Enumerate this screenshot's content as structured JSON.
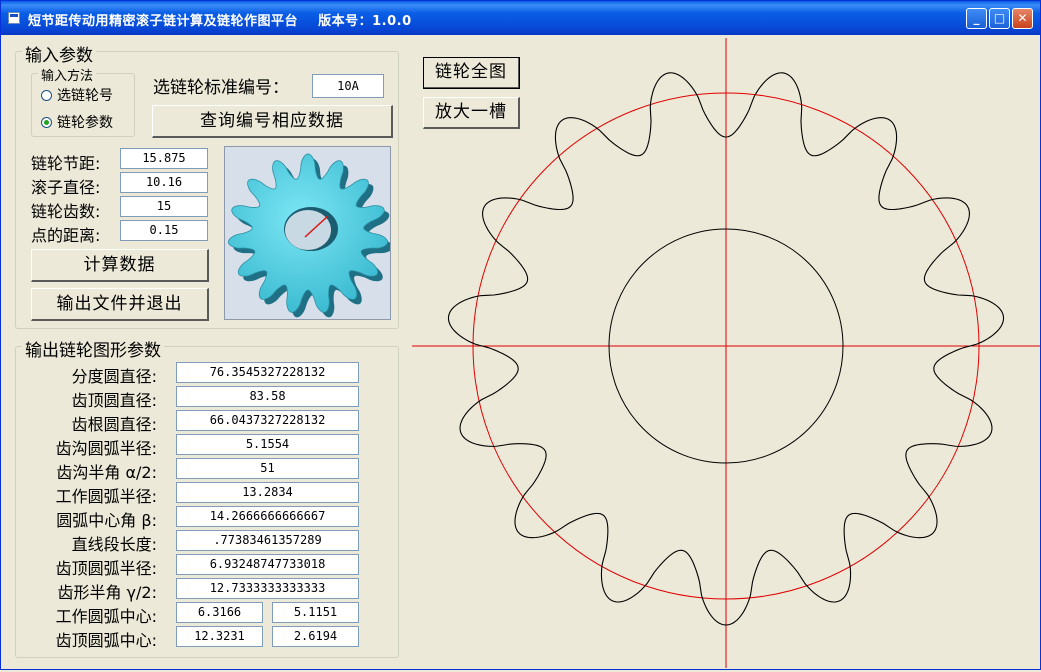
{
  "window": {
    "title": "短节距传动用精密滚子链计算及链轮作图平台    版本号：1.0.0",
    "buttons": {
      "minimize": "_",
      "maximize": "□",
      "close": "✕"
    }
  },
  "input_group": {
    "legend": "输入参数",
    "method_group": {
      "legend": "输入方法",
      "options": [
        {
          "label": "选链轮号",
          "checked": false
        },
        {
          "label": "链轮参数",
          "checked": true
        }
      ]
    },
    "standard_label": "选链轮标准编号：",
    "standard_value": "10A",
    "query_button": "查询编号相应数据",
    "fields": [
      {
        "label": "链轮节距:",
        "value": "15.875"
      },
      {
        "label": "滚子直径:",
        "value": "10.16"
      },
      {
        "label": "链轮齿数:",
        "value": "15"
      },
      {
        "label": "点的距离:",
        "value": "0.15"
      }
    ],
    "calc_button": "计算数据",
    "export_button": "输出文件并退出"
  },
  "output_group": {
    "legend": "输出链轮图形参数",
    "rows": [
      {
        "label": "分度圆直径:",
        "values": [
          "76.3545327228132"
        ]
      },
      {
        "label": "齿顶圆直径:",
        "values": [
          "83.58"
        ]
      },
      {
        "label": "齿根圆直径:",
        "values": [
          "66.0437327228132"
        ]
      },
      {
        "label": "齿沟圆弧半径:",
        "values": [
          "5.1554"
        ]
      },
      {
        "label": "齿沟半角 α/2:",
        "values": [
          "51"
        ]
      },
      {
        "label": "工作圆弧半径:",
        "values": [
          "13.2834"
        ]
      },
      {
        "label": "圆弧中心角 β:",
        "values": [
          "14.2666666666667"
        ]
      },
      {
        "label": "直线段长度:",
        "values": [
          ".77383461357289"
        ]
      },
      {
        "label": "齿顶圆弧半径:",
        "values": [
          "6.93248747733018"
        ]
      },
      {
        "label": "齿形半角 γ/2:",
        "values": [
          "12.7333333333333"
        ]
      },
      {
        "label": "工作圆弧中心:",
        "values": [
          "6.3166",
          "5.1151"
        ]
      },
      {
        "label": "齿顶圆弧中心:",
        "values": [
          "12.3231",
          "2.6194"
        ]
      }
    ]
  },
  "view_buttons": {
    "full": "链轮全图",
    "zoom": "放大一槽"
  },
  "drawing": {
    "teeth": 15,
    "pitch_circle_color": "#e00000",
    "outline_color": "#000000",
    "axis_color": "#e00000"
  },
  "colors": {
    "title_bar": "#0a5fe6",
    "face": "#ece9d8",
    "sprocket_blue": "#5ed8ea"
  }
}
